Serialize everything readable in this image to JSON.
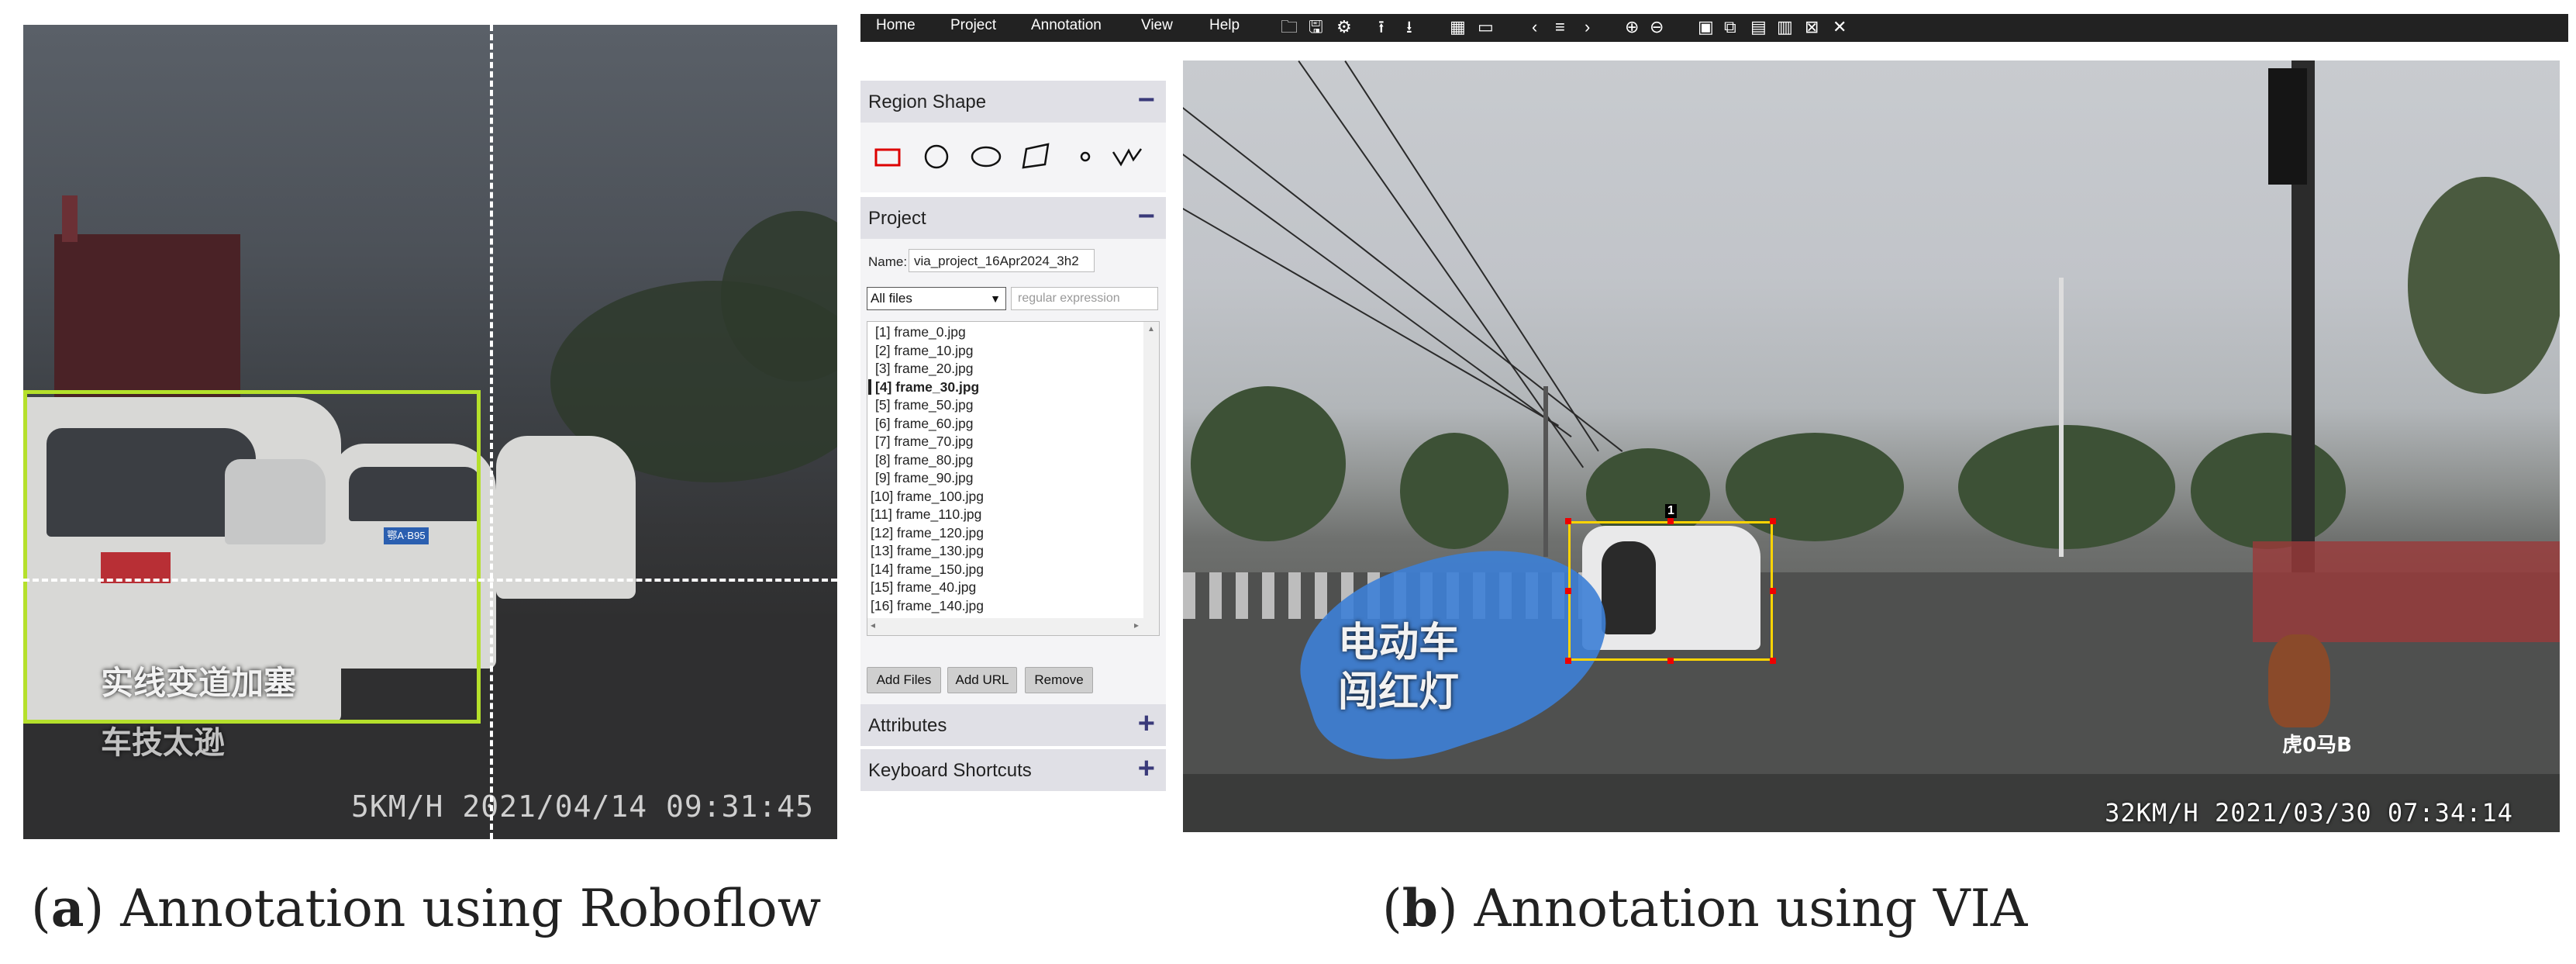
{
  "captions": {
    "a_open": "(",
    "a_letter": "a",
    "a_text": ") Annotation using Roboflow",
    "b_open": "(",
    "b_letter": "b",
    "b_text": ") Annotation using VIA"
  },
  "roboflow": {
    "overlay_text_1": "实线变道加塞",
    "overlay_text_2": "车技太逊",
    "plate_text": "鄂A·B95",
    "timestamp": "5KM/H 2021/04/14 09:31:45",
    "bbox_color": "#b5e02b",
    "crosshair_color": "#ffffff"
  },
  "via": {
    "menu": [
      "Home",
      "Project",
      "Annotation",
      "View",
      "Help"
    ],
    "toolbar_icons": [
      "open-folder-icon",
      "save-icon",
      "settings-icon",
      "upload-icon",
      "download-icon",
      "grid-icon",
      "comment-icon",
      "prev-icon",
      "list-icon",
      "next-icon",
      "zoom-in-icon",
      "zoom-out-icon",
      "select-all-icon",
      "copy-icon",
      "paste-icon",
      "delete-icon",
      "clear-icon",
      "close-icon"
    ],
    "toolbar_glyphs": [
      "🗀",
      "🖫",
      "⚙",
      "⭱",
      "⭳",
      "▦",
      "▭",
      "‹",
      "≡",
      "›",
      "⊕",
      "⊖",
      "▣",
      "⧉",
      "▤",
      "▥",
      "⊠",
      "✕"
    ],
    "region_shape": {
      "title": "Region Shape",
      "toggle": "−"
    },
    "project": {
      "title": "Project",
      "toggle": "−",
      "name_label": "Name:",
      "name_value": "via_project_16Apr2024_3h2",
      "filter_selected": "All files",
      "regex_placeholder": "regular expression",
      "files": [
        "[1] frame_0.jpg",
        "[2] frame_10.jpg",
        "[3] frame_20.jpg",
        "[4] frame_30.jpg",
        "[5] frame_50.jpg",
        "[6] frame_60.jpg",
        "[7] frame_70.jpg",
        "[8] frame_80.jpg",
        "[9] frame_90.jpg",
        "[10] frame_100.jpg",
        "[11] frame_110.jpg",
        "[12] frame_120.jpg",
        "[13] frame_130.jpg",
        "[14] frame_150.jpg",
        "[15] frame_40.jpg",
        "[16] frame_140.jpg"
      ],
      "selected_index": 3,
      "buttons": {
        "add_files": "Add Files",
        "add_url": "Add URL",
        "remove": "Remove"
      }
    },
    "attributes": {
      "title": "Attributes",
      "toggle": "+"
    },
    "shortcuts": {
      "title": "Keyboard Shortcuts",
      "toggle": "+"
    },
    "canvas": {
      "overlay_text_1": "电动车",
      "overlay_text_2": "闯红灯",
      "region_id": "1",
      "watermark": "虎0马B",
      "timestamp": "32KM/H 2021/03/30 07:34:14",
      "bbox_color": "#ffd400",
      "handle_color": "#e00000"
    }
  }
}
